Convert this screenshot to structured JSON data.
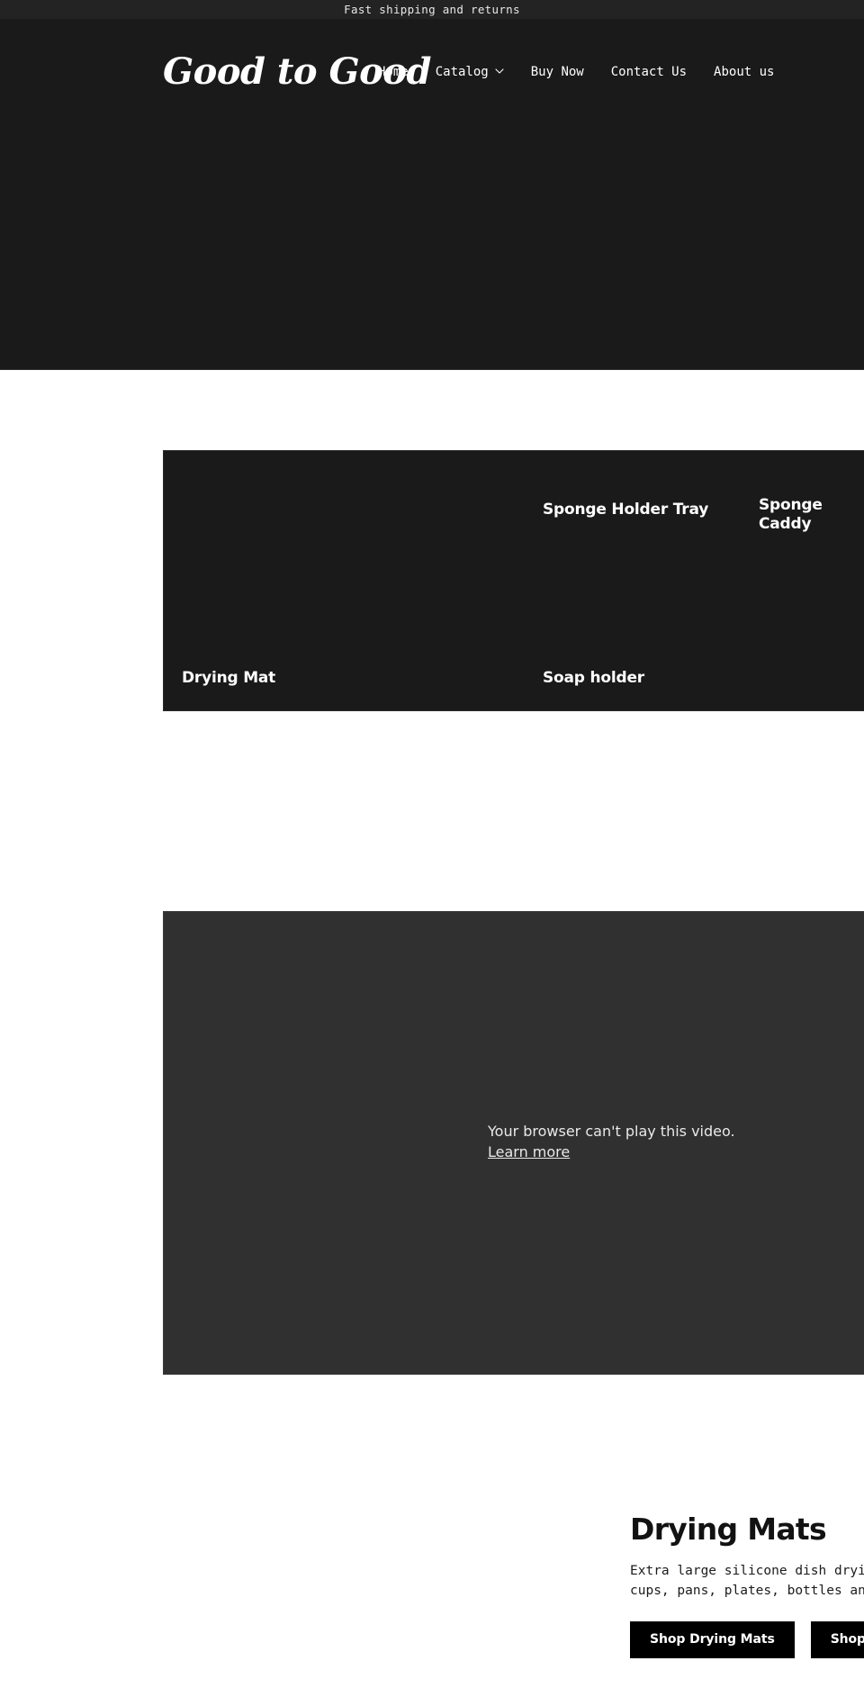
{
  "announcement": {
    "text": "Fast shipping and returns"
  },
  "header": {
    "logo": "Good to Good",
    "nav": [
      {
        "label": "Home",
        "has_dropdown": false,
        "icon": ""
      },
      {
        "label": "Catalog",
        "has_dropdown": true,
        "icon": "chevron-down-icon"
      },
      {
        "label": "Buy Now",
        "has_dropdown": false,
        "icon": ""
      },
      {
        "label": "Contact Us",
        "has_dropdown": false,
        "icon": ""
      },
      {
        "label": "About us",
        "has_dropdown": false,
        "icon": ""
      }
    ]
  },
  "collections": {
    "cards": [
      {
        "title": "Drying Mat"
      },
      {
        "title": "Sponge Holder Tray"
      },
      {
        "title": "Sponge Caddy"
      },
      {
        "title": "Soap holder"
      },
      {
        "title": ""
      }
    ]
  },
  "video": {
    "fallback_message": "Your browser can't play this video.",
    "fallback_link": "Learn more"
  },
  "promo": {
    "title": "Drying Mats",
    "body": "Extra large silicone dish drying mat for kitchen counter, holds washed cups, pans, plates, bottles and more",
    "primary_button": "Shop Drying Mats",
    "secondary_button": "Shop All"
  },
  "colors": {
    "announcement_bg": "#232323",
    "header_bg": "#1a1a1a",
    "card_bg": "#1a1a1a",
    "video_bg": "#303030",
    "button_bg": "#000000",
    "page_bg": "#ffffff",
    "text_light": "#ffffff",
    "text_dark": "#121212"
  }
}
